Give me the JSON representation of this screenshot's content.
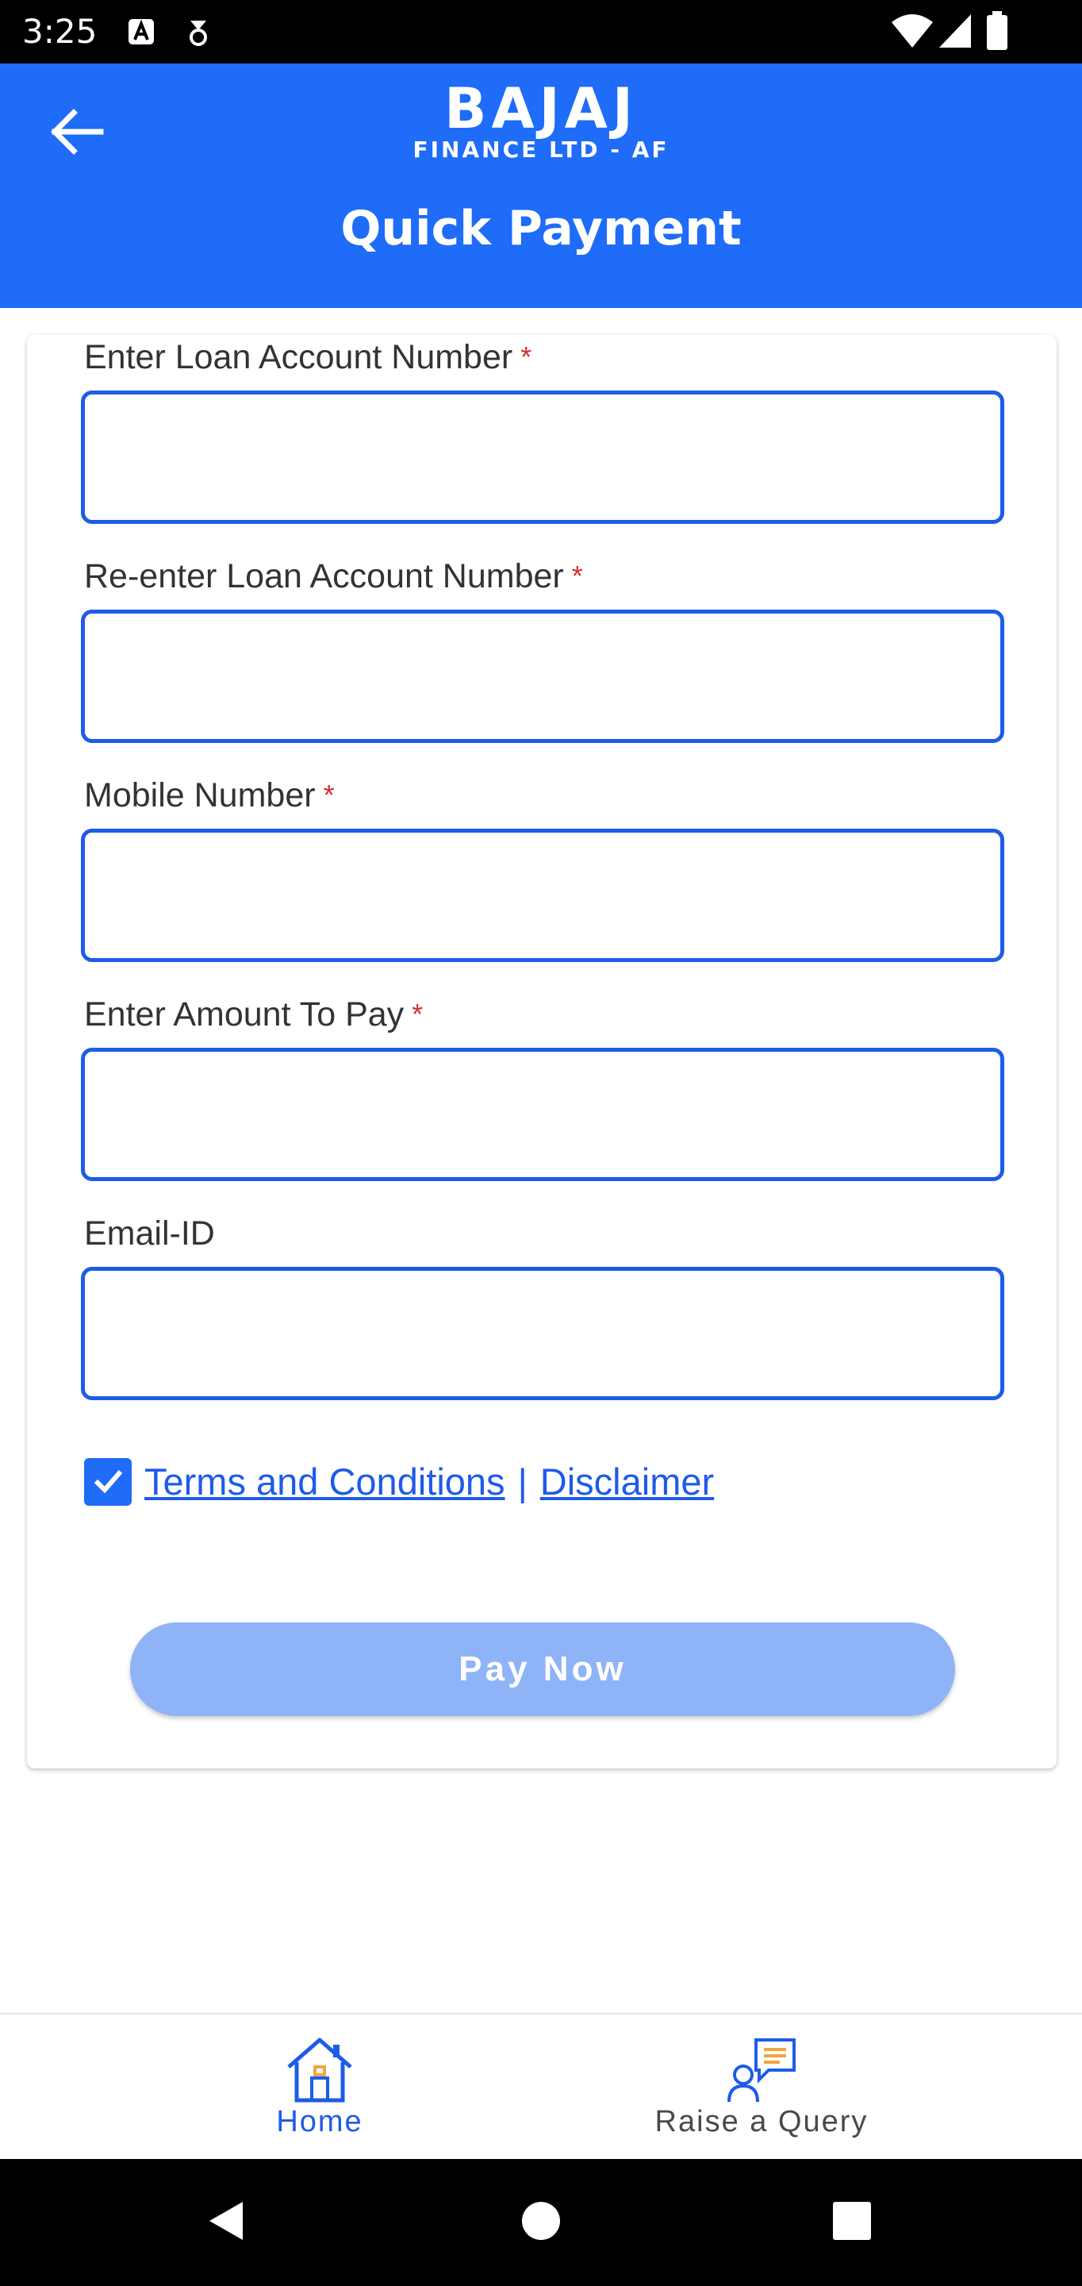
{
  "status_bar": {
    "time": "3:25",
    "icons": [
      "notification-a-icon",
      "usb-debug-icon",
      "wifi-icon",
      "signal-icon",
      "battery-icon"
    ]
  },
  "header": {
    "back_icon": "arrow-left-icon",
    "logo_main": "BAJAJ",
    "logo_sub": "FINANCE LTD - AF",
    "title": "Quick Payment",
    "background_color": "#1e6cf7"
  },
  "form": {
    "fields": [
      {
        "label": "Enter Loan Account Number",
        "required_mark": "*",
        "value": "",
        "placeholder": ""
      },
      {
        "label": "Re-enter Loan Account Number",
        "required_mark": "*",
        "value": "",
        "placeholder": ""
      },
      {
        "label": "Mobile Number",
        "required_mark": "*",
        "value": "",
        "placeholder": ""
      },
      {
        "label": "Enter Amount To Pay",
        "required_mark": "*",
        "value": "",
        "placeholder": ""
      },
      {
        "label": "Email-ID",
        "value": "",
        "placeholder": ""
      }
    ],
    "terms": {
      "checked": true,
      "terms_link": "Terms and Conditions",
      "separator": "|",
      "disclaimer_link": "Disclaimer"
    },
    "pay_button": {
      "label": "Pay Now",
      "disabled": true,
      "color": "#8fb3f7"
    },
    "input_border_color": "#1e5be8"
  },
  "bottom_nav": {
    "items": [
      {
        "label": "Home",
        "icon": "home-icon",
        "active": true
      },
      {
        "label": "Raise a Query",
        "icon": "query-icon",
        "active": false
      }
    ]
  },
  "system_nav": {
    "icons": [
      "back-triangle-icon",
      "home-circle-icon",
      "recents-square-icon"
    ]
  }
}
